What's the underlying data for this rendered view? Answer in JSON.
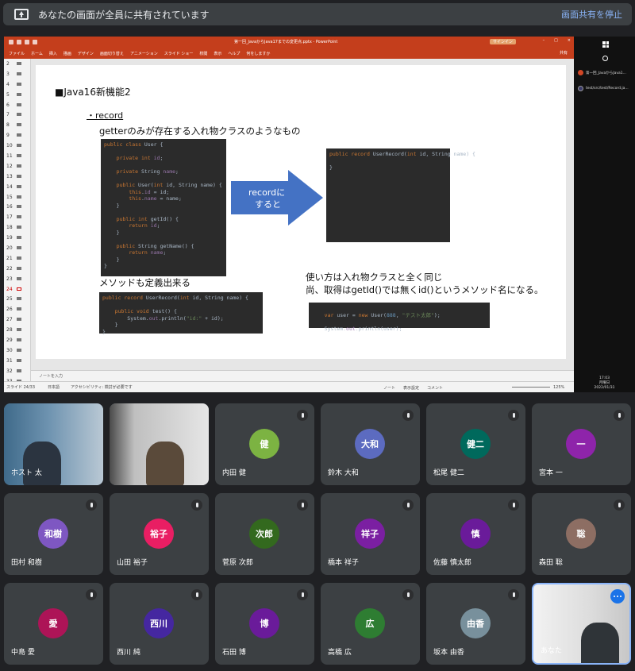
{
  "banner": {
    "message": "あなたの画面が全員に共有されています",
    "stop_label": "画面共有を停止"
  },
  "ppt": {
    "doc_title": "第一回_JavaからJava17までの変更点.pptx - PowerPoint",
    "signin_label": "サインイン",
    "ribbon_tabs": [
      "ファイル",
      "ホーム",
      "挿入",
      "描画",
      "デザイン",
      "画面切り替え",
      "アニメーション",
      "スライド ショー",
      "校閲",
      "表示",
      "ヘルプ",
      "何をしますか"
    ],
    "share_label": "共有",
    "thumb_numbers": [
      "2",
      "3",
      "4",
      "5",
      "6",
      "7",
      "8",
      "9",
      "10",
      "11",
      "12",
      "13",
      "14",
      "15",
      "16",
      "17",
      "18",
      "19",
      "20",
      "21",
      "22",
      "23",
      "24",
      "25",
      "26",
      "27",
      "28",
      "29",
      "30",
      "31",
      "32",
      "33"
    ],
    "active_slide": "24",
    "notes_placeholder": "ノートを入力",
    "status_slide": "スライド 24/33",
    "status_lang": "日本語",
    "status_access": "アクセシビリティ: 検討が必要です",
    "status_notes": "ノート",
    "status_view": "表示設定",
    "status_comment": "コメント",
    "zoom": "125%"
  },
  "slide": {
    "heading": "■Java16新機能2",
    "bullet": "・record",
    "desc": "getterのみが存在する入れ物クラスのようなもの",
    "arrow_label_1": "recordに",
    "arrow_label_2": "すると",
    "method_label": "メソッドも定義出来る",
    "usage_1": "使い方は入れ物クラスと全く同じ",
    "usage_2": "尚、取得はgetId()では無くid()というメソッド名になる。"
  },
  "taskbar": {
    "item1": "第一回_JavaからJava1...",
    "item2": "test/src/test/Record.ja...",
    "time": "17:03",
    "weekday": "月曜日",
    "date": "2022/01/31"
  },
  "participants": [
    {
      "name": "ホスト 太",
      "initials": "",
      "color": "#5f6368",
      "video": true
    },
    {
      "name": "",
      "initials": "",
      "color": "#5f6368",
      "video": true
    },
    {
      "name": "内田 健",
      "initials": "健",
      "color": "#7cb342"
    },
    {
      "name": "鈴木 大和",
      "initials": "大和",
      "color": "#5c6bc0"
    },
    {
      "name": "松尾 健二",
      "initials": "健二",
      "color": "#00695c"
    },
    {
      "name": "宮本 一",
      "initials": "一",
      "color": "#8e24aa"
    },
    {
      "name": "田村 和樹",
      "initials": "和樹",
      "color": "#7e57c2"
    },
    {
      "name": "山田 裕子",
      "initials": "裕子",
      "color": "#e91e63"
    },
    {
      "name": "菅原 次郎",
      "initials": "次郎",
      "color": "#33691e"
    },
    {
      "name": "橋本 祥子",
      "initials": "祥子",
      "color": "#7b1fa2"
    },
    {
      "name": "佐藤 慎太郎",
      "initials": "慎",
      "color": "#6a1b9a"
    },
    {
      "name": "森田 聡",
      "initials": "聡",
      "color": "#8d6e63"
    },
    {
      "name": "中島 愛",
      "initials": "愛",
      "color": "#ad1457"
    },
    {
      "name": "西川 純",
      "initials": "西川",
      "color": "#4527a0"
    },
    {
      "name": "石田 博",
      "initials": "博",
      "color": "#6a1b9a"
    },
    {
      "name": "高橋 広",
      "initials": "広",
      "color": "#2e7d32"
    },
    {
      "name": "坂本 由香",
      "initials": "由香",
      "color": "#78909c"
    },
    {
      "name": "あなた",
      "initials": "",
      "color": "#5f6368",
      "video": true,
      "self": true
    }
  ]
}
